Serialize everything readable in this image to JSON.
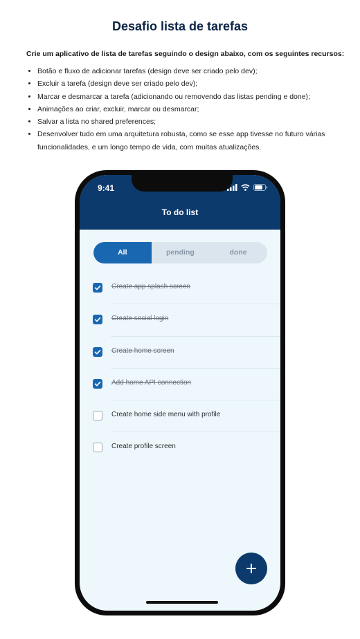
{
  "doc": {
    "title": "Desafio lista de tarefas",
    "intro": "Crie um aplicativo de lista de tarefas seguindo o design abaixo, com os seguintes recursos:",
    "requirements": [
      "Botão e fluxo de adicionar tarefas (design deve ser criado pelo dev);",
      "Excluir a tarefa (design deve ser criado pelo dev);",
      "Marcar e desmarcar a tarefa (adicionando ou removendo das listas pending e done);",
      "Animações ao criar, excluir, marcar ou desmarcar;",
      "Salvar a lista no shared preferences;",
      "Desenvolver tudo em uma arquitetura robusta, como se esse app tivesse no futuro várias funcionalidades, e um longo tempo de vida, com muitas atualizações."
    ]
  },
  "phone": {
    "status": {
      "time": "9:41"
    },
    "app_title": "To do list",
    "filter_tabs": [
      "All",
      "pending",
      "done"
    ],
    "active_tab": "All",
    "tasks": [
      {
        "label": "Create app splash screen",
        "done": true
      },
      {
        "label": "Create social login",
        "done": true
      },
      {
        "label": "Create home screen",
        "done": true
      },
      {
        "label": "Add home API connection",
        "done": true
      },
      {
        "label": "Create home side menu with profile",
        "done": false
      },
      {
        "label": "Create profile screen",
        "done": false
      }
    ],
    "fab_icon": "plus-icon",
    "colors": {
      "primary": "#0d3a6c",
      "accent": "#1a67b1",
      "screen_bg": "#eef8fc",
      "segment_bg": "#dbe5ee"
    }
  }
}
